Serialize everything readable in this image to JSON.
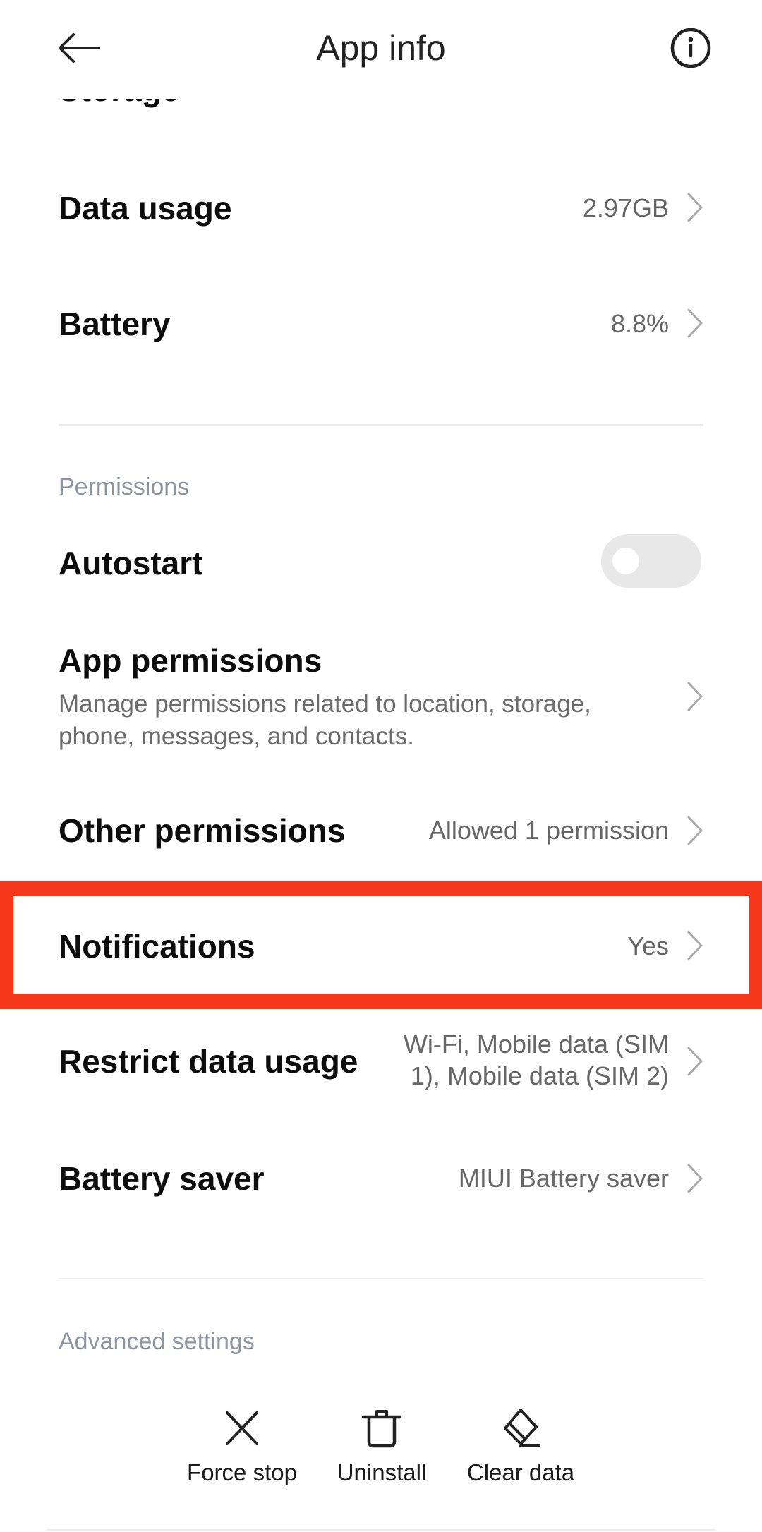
{
  "header": {
    "title": "App info",
    "back_icon": "arrow-left-icon",
    "info_icon": "info-circle-icon"
  },
  "rows_top": [
    {
      "title": "Storage",
      "value": ""
    },
    {
      "title": "Data usage",
      "value": "2.97GB"
    },
    {
      "title": "Battery",
      "value": "8.8%"
    }
  ],
  "permissions": {
    "section_label": "Permissions",
    "autostart": {
      "title": "Autostart",
      "enabled": false
    },
    "app_permissions": {
      "title": "App permissions",
      "subtitle": "Manage permissions related to location, storage, phone, messages, and contacts."
    },
    "other_permissions": {
      "title": "Other permissions",
      "value": "Allowed 1 permission"
    },
    "notifications": {
      "title": "Notifications",
      "value": "Yes",
      "highlighted": true,
      "highlight_color": "#F5381A"
    },
    "restrict_data_usage": {
      "title": "Restrict data usage",
      "value_line1": "Wi-Fi, Mobile data (SIM",
      "value_line2": "1), Mobile data (SIM 2)"
    },
    "battery_saver": {
      "title": "Battery saver",
      "value": "MIUI Battery saver"
    }
  },
  "advanced": {
    "section_label": "Advanced settings",
    "actions": [
      {
        "label": "Force stop",
        "icon": "close-x-icon"
      },
      {
        "label": "Uninstall",
        "icon": "trash-icon"
      },
      {
        "label": "Clear data",
        "icon": "eraser-icon"
      }
    ]
  }
}
